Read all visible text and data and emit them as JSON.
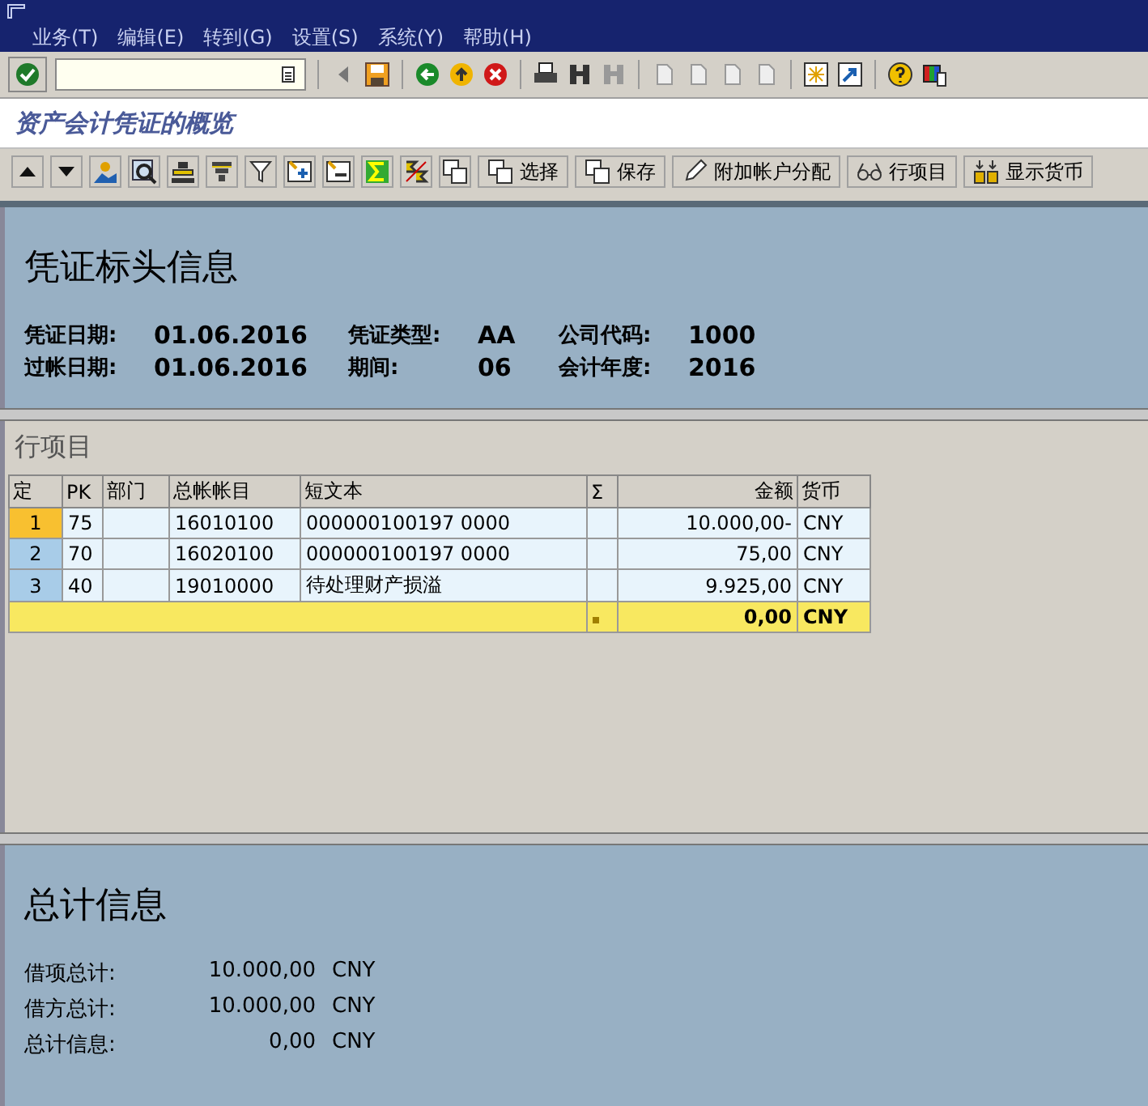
{
  "menu": [
    {
      "label": "业务(T)"
    },
    {
      "label": "编辑(E)"
    },
    {
      "label": "转到(G)"
    },
    {
      "label": "设置(S)"
    },
    {
      "label": "系统(Y)"
    },
    {
      "label": "帮助(H)"
    }
  ],
  "screen_title": "资产会计凭证的概览",
  "app_toolbar": {
    "buttons": [
      {
        "label": "选择",
        "kind": "copy"
      },
      {
        "label": "保存",
        "kind": "copy"
      },
      {
        "label": "附加帐户分配",
        "kind": "pencil"
      },
      {
        "label": "行项目",
        "kind": "glasses"
      },
      {
        "label": "显示货币",
        "kind": "coins"
      }
    ]
  },
  "header": {
    "title": "凭证标头信息",
    "fields": [
      {
        "label": "凭证日期:",
        "value": "01.06.2016"
      },
      {
        "label": "凭证类型:",
        "value": "AA"
      },
      {
        "label": "公司代码:",
        "value": "1000"
      },
      {
        "label": "过帐日期:",
        "value": "01.06.2016"
      },
      {
        "label": "期间:",
        "value": "06"
      },
      {
        "label": "会计年度:",
        "value": "2016"
      }
    ]
  },
  "line_items": {
    "title": "行项目",
    "columns": [
      "定",
      "PK",
      "部门",
      "总帐帐目",
      "短文本",
      "Σ",
      "金额",
      "货币"
    ],
    "rows": [
      {
        "selected": true,
        "cells": [
          "1",
          "75",
          "",
          "16010100",
          "000000100197 0000",
          "",
          "10.000,00-",
          "CNY"
        ]
      },
      {
        "selected": false,
        "cells": [
          "2",
          "70",
          "",
          "16020100",
          "000000100197 0000",
          "",
          "75,00",
          "CNY"
        ]
      },
      {
        "selected": false,
        "cells": [
          "3",
          "40",
          "",
          "19010000",
          "待处理财产损溢",
          "",
          "9.925,00",
          "CNY"
        ]
      }
    ],
    "total": {
      "amount": "0,00",
      "currency": "CNY"
    }
  },
  "totals": {
    "title": "总计信息",
    "rows": [
      {
        "label": "借项总计:",
        "amount": "10.000,00",
        "currency": "CNY"
      },
      {
        "label": "借方总计:",
        "amount": "10.000,00",
        "currency": "CNY"
      },
      {
        "label": "总计信息:",
        "amount": "0,00",
        "currency": "CNY"
      }
    ]
  }
}
